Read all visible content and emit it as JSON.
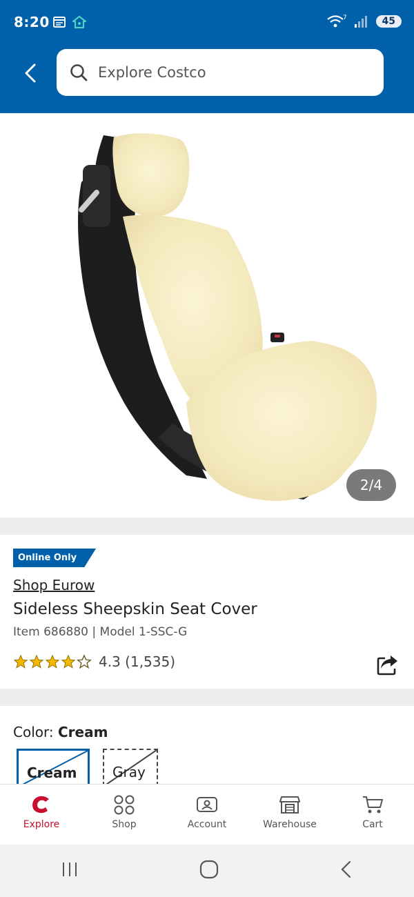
{
  "status_bar": {
    "time": "8:20",
    "battery": "45",
    "wifi_sup": "7"
  },
  "header": {
    "search_placeholder": "Explore Costco"
  },
  "gallery": {
    "counter": "2/4"
  },
  "product": {
    "badge": "Online Only",
    "brand": "Shop Eurow",
    "title": "Sideless Sheepskin Seat Cover",
    "item_line": "Item 686880 | Model 1-SSC-G",
    "rating_value": 4.3,
    "rating_text": "4.3 (1,535)"
  },
  "color": {
    "label": "Color: ",
    "selected": "Cream",
    "options": [
      "Cream",
      "Gray"
    ]
  },
  "bottom_nav": {
    "items": [
      {
        "label": "Explore",
        "icon": "costco-logo-icon"
      },
      {
        "label": "Shop",
        "icon": "grid-icon"
      },
      {
        "label": "Account",
        "icon": "account-icon"
      },
      {
        "label": "Warehouse",
        "icon": "warehouse-icon"
      },
      {
        "label": "Cart",
        "icon": "cart-icon"
      }
    ]
  },
  "colors": {
    "brand_blue": "#0060a9",
    "costco_red": "#c8102e",
    "star_gold": "#f5b800"
  }
}
